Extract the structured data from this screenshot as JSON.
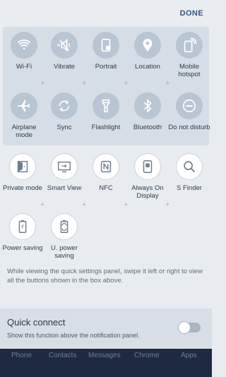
{
  "header": {
    "done_label": "DONE"
  },
  "panel_tiles": [
    {
      "label": "Wi-Fi",
      "icon": "wifi-icon"
    },
    {
      "label": "Vibrate",
      "icon": "vibrate-icon"
    },
    {
      "label": "Portrait",
      "icon": "screen-rotation-icon"
    },
    {
      "label": "Location",
      "icon": "location-pin-icon"
    },
    {
      "label": "Mobile hotspot",
      "icon": "hotspot-icon"
    },
    {
      "label": "Airplane mode",
      "icon": "airplane-icon"
    },
    {
      "label": "Sync",
      "icon": "sync-icon"
    },
    {
      "label": "Flashlight",
      "icon": "flashlight-icon"
    },
    {
      "label": "Bluetooth",
      "icon": "bluetooth-icon"
    },
    {
      "label": "Do not disturb",
      "icon": "do-not-disturb-icon"
    }
  ],
  "extra_tiles": [
    {
      "label": "Private mode",
      "icon": "private-mode-icon"
    },
    {
      "label": "Smart View",
      "icon": "smart-view-icon"
    },
    {
      "label": "NFC",
      "icon": "nfc-icon"
    },
    {
      "label": "Always On Display",
      "icon": "always-on-display-icon"
    },
    {
      "label": "S Finder",
      "icon": "search-icon"
    },
    {
      "label": "Power saving",
      "icon": "battery-icon"
    },
    {
      "label": "U. power saving",
      "icon": "ultra-power-saving-icon"
    }
  ],
  "hint_text": "While viewing the quick settings panel, swipe it left or right to view all the buttons shown in the box above.",
  "quick_connect": {
    "title": "Quick connect",
    "description": "Show this function above the notification panel.",
    "enabled": false
  },
  "dock": [
    "Phone",
    "Contacts",
    "Messages",
    "Chrome",
    "Apps"
  ],
  "colors": {
    "background": "#e8ecf0",
    "panel": "#d5dde6",
    "active_circle": "#b8c5d3",
    "dock": "#1d2a3f",
    "accent": "#3a5878"
  }
}
